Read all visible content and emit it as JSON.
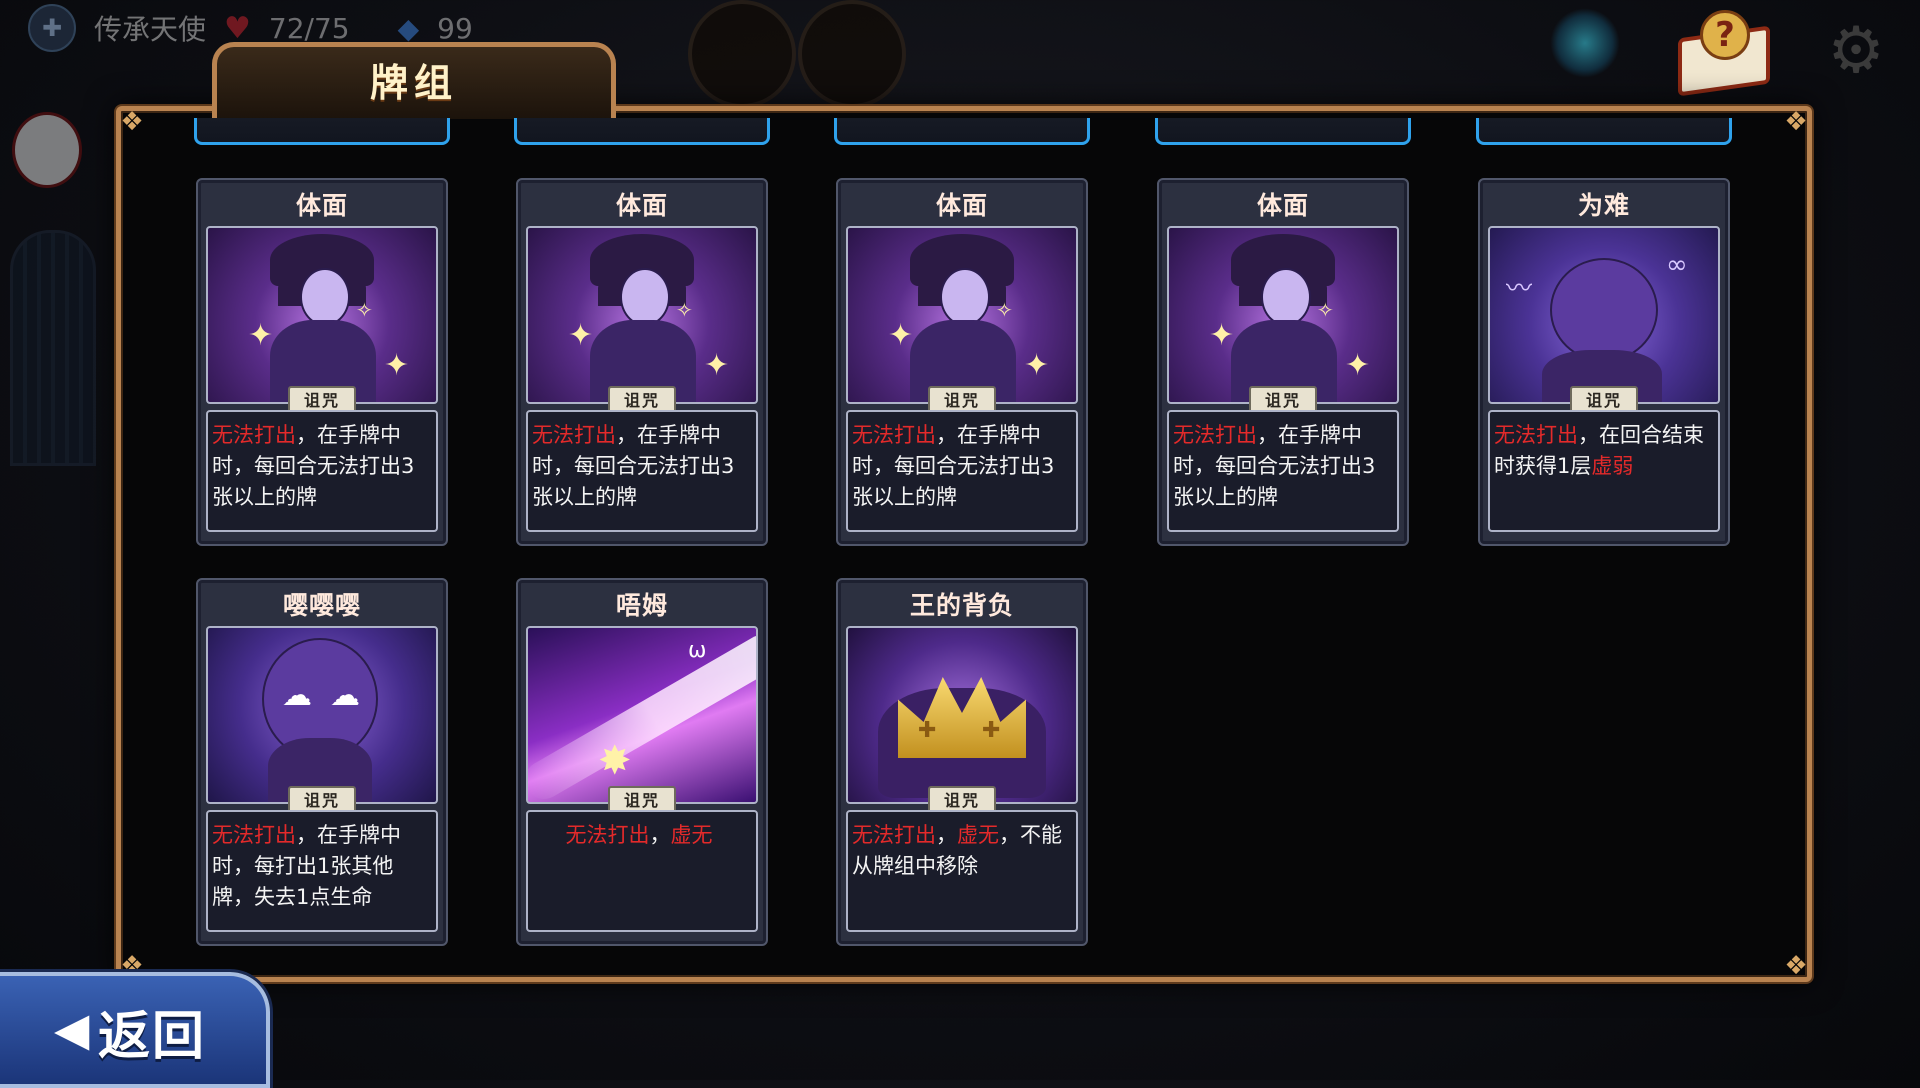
{
  "top_bar": {
    "player_name": "传承天使",
    "hp": "72/75",
    "gems": "99",
    "icons": [
      "player-emblem-icon",
      "heart-icon",
      "gem-icon",
      "help-book-icon",
      "gear-icon"
    ]
  },
  "panel": {
    "title": "牌组"
  },
  "cards": [
    {
      "name": "体面",
      "type_tag": "诅咒",
      "art": "gentleman",
      "desc_parts": [
        {
          "text": "无法打出",
          "kw": true
        },
        {
          "text": "，在手牌中时，每回合无法打出3张以上的牌",
          "kw": false
        }
      ]
    },
    {
      "name": "体面",
      "type_tag": "诅咒",
      "art": "gentleman",
      "desc_parts": [
        {
          "text": "无法打出",
          "kw": true
        },
        {
          "text": "，在手牌中时，每回合无法打出3张以上的牌",
          "kw": false
        }
      ]
    },
    {
      "name": "体面",
      "type_tag": "诅咒",
      "art": "gentleman",
      "desc_parts": [
        {
          "text": "无法打出",
          "kw": true
        },
        {
          "text": "，在手牌中时，每回合无法打出3张以上的牌",
          "kw": false
        }
      ]
    },
    {
      "name": "体面",
      "type_tag": "诅咒",
      "art": "gentleman",
      "desc_parts": [
        {
          "text": "无法打出",
          "kw": true
        },
        {
          "text": "，在手牌中时，每回合无法打出3张以上的牌",
          "kw": false
        }
      ]
    },
    {
      "name": "为难",
      "type_tag": "诅咒",
      "art": "embarrass",
      "desc_parts": [
        {
          "text": "无法打出",
          "kw": true
        },
        {
          "text": "，在回合结束时获得1层",
          "kw": false
        },
        {
          "text": "虚弱",
          "kw": true
        }
      ]
    },
    {
      "name": "嘤嘤嘤",
      "type_tag": "诅咒",
      "art": "sob",
      "desc_parts": [
        {
          "text": "无法打出",
          "kw": true
        },
        {
          "text": "，在手牌中时，每打出1张其他牌，失去1点生命",
          "kw": false
        }
      ]
    },
    {
      "name": "唔姆",
      "type_tag": "诅咒",
      "art": "wum",
      "center": true,
      "desc_parts": [
        {
          "text": "无法打出",
          "kw": true
        },
        {
          "text": "，",
          "kw": false
        },
        {
          "text": "虚无",
          "kw": true
        }
      ]
    },
    {
      "name": "王的背负",
      "type_tag": "诅咒",
      "art": "crown",
      "desc_parts": [
        {
          "text": "无法打出",
          "kw": true
        },
        {
          "text": "，",
          "kw": false
        },
        {
          "text": "虚无",
          "kw": true
        },
        {
          "text": "，不能从牌组中移除",
          "kw": false
        }
      ]
    }
  ],
  "back_button": {
    "label": "返回"
  },
  "colors": {
    "keyword": "#e42a2a",
    "frame_gold": "#b98350",
    "card_edge_blue": "#2fa2ec"
  }
}
